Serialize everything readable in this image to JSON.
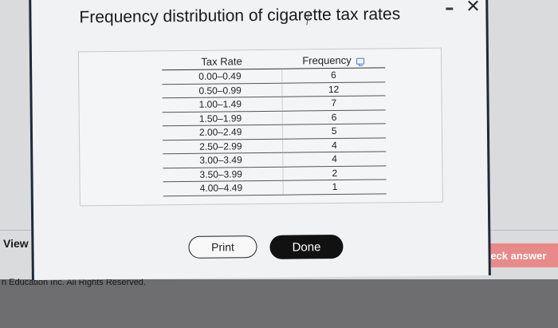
{
  "background": {
    "view_link": "View a",
    "copyright": "n Education Inc. All Rights Reserved.",
    "check_answer": "Check answer"
  },
  "dialog": {
    "title": "Frequency distribution of cigarette tax rates",
    "table": {
      "headers": {
        "rate": "Tax Rate",
        "frequency": "Frequency"
      },
      "rows": [
        {
          "rate": "0.00–0.49",
          "frequency": "6"
        },
        {
          "rate": "0.50–0.99",
          "frequency": "12"
        },
        {
          "rate": "1.00–1.49",
          "frequency": "7"
        },
        {
          "rate": "1.50–1.99",
          "frequency": "6"
        },
        {
          "rate": "2.00–2.49",
          "frequency": "5"
        },
        {
          "rate": "2.50–2.99",
          "frequency": "4"
        },
        {
          "rate": "3.00–3.49",
          "frequency": "4"
        },
        {
          "rate": "3.50–3.99",
          "frequency": "2"
        },
        {
          "rate": "4.00–4.49",
          "frequency": "1"
        }
      ]
    },
    "print_label": "Print",
    "done_label": "Done"
  },
  "colors": {
    "check_button": "#e88a89",
    "done_button": "#111111"
  }
}
